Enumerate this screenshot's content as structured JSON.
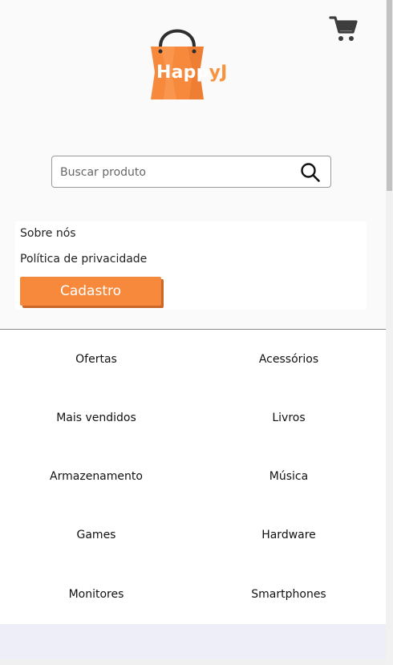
{
  "header": {
    "logo_text_main": "Happ",
    "logo_text_accent": "yJ",
    "cart_icon": "shopping-cart-icon"
  },
  "search": {
    "placeholder": "Buscar produto",
    "value": "",
    "icon": "search-icon"
  },
  "menu": {
    "about_label": "Sobre nós",
    "privacy_label": "Política de privacidade",
    "signup_label": "Cadastro"
  },
  "categories": [
    "Ofertas",
    "Acessórios",
    "Mais vendidos",
    "Livros",
    "Armazenamento",
    "Música",
    "Games",
    "Hardware",
    "Monitores",
    "Smartphones"
  ],
  "colors": {
    "brand_orange": "#f7893d",
    "footer_band": "#eeeef9"
  }
}
